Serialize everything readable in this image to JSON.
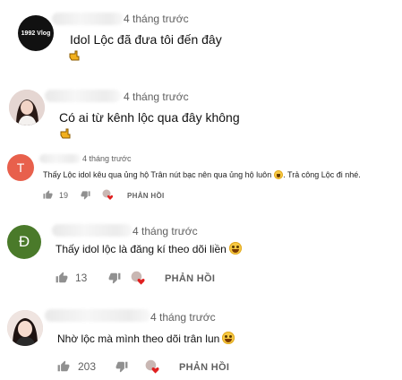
{
  "comments": [
    {
      "avatar_text": "1992 Vlog",
      "avatar_color": "#111111",
      "time": "4 tháng trước",
      "text": "Idol Lộc đã đưa tôi đến đây",
      "reaction_icon": "pointing-hand-icon"
    },
    {
      "avatar_icon": "girl-photo-avatar",
      "time": "4 tháng trước",
      "text": "Có ai từ kênh lộc qua đây không",
      "reaction_icon": "pointing-hand-icon"
    },
    {
      "avatar_text": "T",
      "avatar_color": "#e8604c",
      "time": "4 tháng trước",
      "text": "Thấy Lộc idol kêu qua ủng hộ Trân nút bạc nên qua ủng hộ luôn",
      "text_after": ". Trả công Lộc đi nhé.",
      "likes": "19",
      "reply_label": "PHẢN HỒI"
    },
    {
      "avatar_text": "Đ",
      "avatar_color": "#4a7a2a",
      "time": "4 tháng trước",
      "text": "Thấy idol lộc là đăng kí theo dõi liền",
      "likes": "13",
      "reply_label": "PHẢN HỒI"
    },
    {
      "avatar_icon": "girl-photo-avatar",
      "time": "4 tháng trước",
      "text": "Nhờ lộc mà mình theo dõi trân lun",
      "likes": "203",
      "reply_label": "PHẢN HỒI"
    }
  ]
}
